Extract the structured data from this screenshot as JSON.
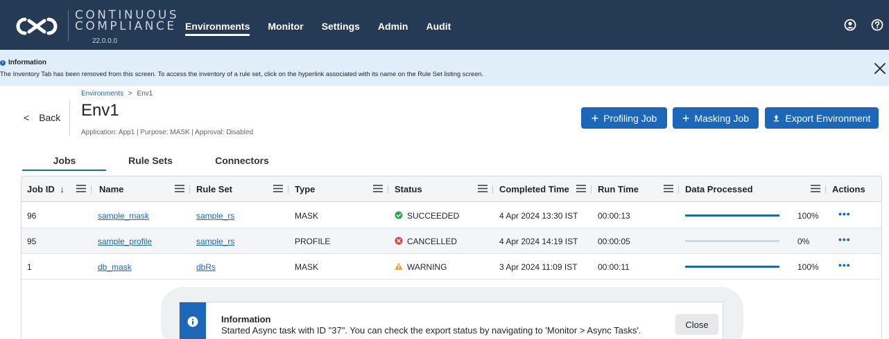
{
  "app": {
    "brand_line1": "CONTINUOUS",
    "brand_line2": "COMPLIANCE",
    "version": "22.0.0.0",
    "nav": [
      "Environments",
      "Monitor",
      "Settings",
      "Admin",
      "Audit"
    ],
    "active_nav": "Environments",
    "icons": [
      "user-icon",
      "help-icon"
    ]
  },
  "banner": {
    "title": "Information",
    "text": "The Inventory Tab has been removed from this screen. To access the inventory of a rule set, click on the hyperlink associated with its name on the Rule Set listing screen."
  },
  "header": {
    "back_label": "Back",
    "breadcrumb_root": "Environments",
    "breadcrumb_sep": ">",
    "breadcrumb_current": "Env1",
    "title": "Env1",
    "subtitle": "Application: App1 | Purpose: MASK | Approval: Disabled",
    "buttons": {
      "profiling": "Profiling Job",
      "masking": "Masking Job",
      "export": "Export Environment"
    }
  },
  "tabs": [
    "Jobs",
    "Rule Sets",
    "Connectors"
  ],
  "table": {
    "columns": {
      "job_id": "Job ID",
      "name": "Name",
      "rule_set": "Rule Set",
      "type": "Type",
      "status": "Status",
      "completed_time": "Completed Time",
      "run_time": "Run Time",
      "data_processed": "Data Processed",
      "actions": "Actions"
    },
    "sort_indicator": "↓",
    "rows": [
      {
        "job_id": "96",
        "name": "sample_mask",
        "rule_set": "sample_rs",
        "type": "MASK",
        "status": "SUCCEEDED",
        "status_kind": "success",
        "completed_time": "4 Apr 2024 13:30 IST",
        "run_time": "00:00:13",
        "progress": 100,
        "percent": "100%",
        "actions": "•••"
      },
      {
        "job_id": "95",
        "name": "sample_profile",
        "rule_set": "sample_rs",
        "type": "PROFILE",
        "status": "CANCELLED",
        "status_kind": "cancelled",
        "completed_time": "4 Apr 2024 14:19 IST",
        "run_time": "00:00:05",
        "progress": 0,
        "percent": "0%",
        "actions": "•••"
      },
      {
        "job_id": "1",
        "name": "db_mask",
        "rule_set": "dbRs",
        "type": "MASK",
        "status": "WARNING",
        "status_kind": "warning",
        "completed_time": "3 Apr 2024 11:09 IST",
        "run_time": "00:00:11",
        "progress": 100,
        "percent": "100%",
        "actions": "•••"
      }
    ]
  },
  "toast": {
    "title": "Information",
    "message": "Started Async task with ID \"37\". You can check the export status by navigating to 'Monitor > Async Tasks'.",
    "close_label": "Close"
  },
  "colors": {
    "nav_bg": "#243a55",
    "accent": "#1d67b8",
    "banner_bg": "#dfeef8",
    "success": "#2ea44f",
    "error": "#d93f3f",
    "warning": "#f0a21b"
  }
}
